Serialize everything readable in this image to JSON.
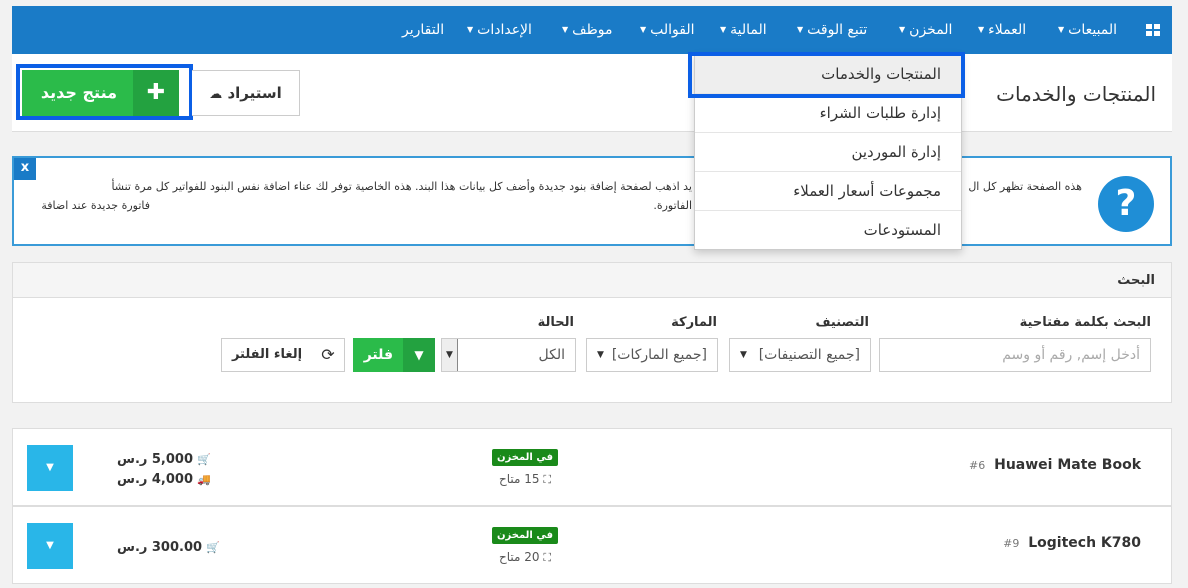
{
  "nav": {
    "items": [
      {
        "label": "المبيعات"
      },
      {
        "label": "العملاء"
      },
      {
        "label": "المخزن"
      },
      {
        "label": "تتبع الوقت"
      },
      {
        "label": "المالية"
      },
      {
        "label": "القوالب"
      },
      {
        "label": "موظف"
      },
      {
        "label": "الإعدادات"
      },
      {
        "label": "التقارير"
      }
    ]
  },
  "header": {
    "title": "المنتجات والخدمات",
    "new_button": "منتج جديد",
    "import_button": "استيراد"
  },
  "dropdown": {
    "items": [
      {
        "label": "المنتجات والخدمات"
      },
      {
        "label": "إدارة طلبات الشراء"
      },
      {
        "label": "إدارة الموردين"
      },
      {
        "label": "مجموعات أسعار العملاء"
      },
      {
        "label": "المستودعات"
      }
    ]
  },
  "info": {
    "close": "x",
    "line1_right": "هذه الصفحة تظهر كل ال",
    "line1_left": "يد اذهب لصفحة إضافة بنود جديدة وأضف كل بيانات هذا البند. هذه الخاصية توفر لك عناء اضافة نفس البنود للفواتير كل مرة تنشأ",
    "line2_right": "فاتورة جديدة عند اضافة",
    "line2_left": "الفاتورة.",
    "icon": "?"
  },
  "search": {
    "title": "البحث",
    "keyword_label": "البحث بكلمة مفتاحية",
    "keyword_placeholder": "أدخل إسم, رقم أو وسم",
    "category_label": "التصنيف",
    "category_value": "[جميع التصنيفات]",
    "brand_label": "الماركة",
    "brand_value": "[جميع الماركات]",
    "status_label": "الحالة",
    "status_value": "الكل",
    "filter_button": "فلتر",
    "cancel_filter_button": "إلغاء الفلتر"
  },
  "products": [
    {
      "name": "Huawei Mate Book",
      "id": "#6",
      "badge": "في المخزن",
      "stock": "15 متاح",
      "sell_price": "5,000 ر.س",
      "buy_price": "4,000 ر.س"
    },
    {
      "name": "Logitech K780",
      "id": "#9",
      "badge": "في المخزن",
      "stock": "20 متاح",
      "sell_price": "300.00 ر.س",
      "buy_price": ""
    }
  ],
  "colors": {
    "nav_bg": "#1a7bc7",
    "green": "#2bbb4a",
    "highlight": "#0b5fe6",
    "badge": "#1a8a1a",
    "toggle": "#29b6e8"
  }
}
